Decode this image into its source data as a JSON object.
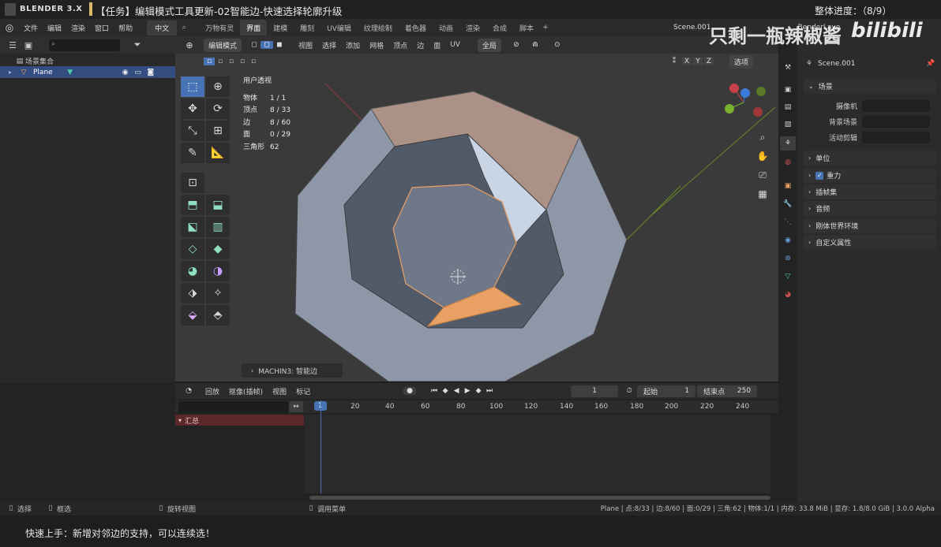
{
  "title_strip": {
    "app_name": "BLENDER 3.X",
    "task_title": "【任务】编辑模式工具更新-02智能边-快速选择轮廓升级",
    "progress": "整体进度：（8/9）"
  },
  "menubar": {
    "menus": [
      "文件",
      "编辑",
      "渲染",
      "窗口",
      "帮助"
    ],
    "language": "中文",
    "workspaces": [
      "万物有灵",
      "界面",
      "建模",
      "雕刻",
      "UV编辑",
      "纹理绘制",
      "着色器",
      "动画",
      "渲染",
      "合成",
      "脚本"
    ],
    "active_workspace": "界面",
    "scene_name": "Scene.001",
    "view_layer": "BenderLaye"
  },
  "watermark": {
    "text": "只剩一瓶辣椒酱",
    "brand": "bilibili"
  },
  "outliner": {
    "collection": "场景集合",
    "object": "Plane"
  },
  "viewport": {
    "mode": "编辑模式",
    "menus": [
      "视图",
      "选择",
      "添加",
      "网格",
      "顶点",
      "边",
      "面",
      "UV"
    ],
    "transform_orientation": "全局",
    "options_label": "选项",
    "axes": [
      "X",
      "Y",
      "Z"
    ],
    "view_name": "用户透视",
    "stats": [
      {
        "label": "物体",
        "value": "1 / 1"
      },
      {
        "label": "顶点",
        "value": "8 / 33"
      },
      {
        "label": "边",
        "value": "8 / 60"
      },
      {
        "label": "面",
        "value": "0 / 29"
      },
      {
        "label": "三角形",
        "value": "62"
      }
    ],
    "operator_panel": "MACHIN3: 智能边"
  },
  "properties": {
    "scene_name": "Scene.001",
    "scene_panel": "场景",
    "fields": [
      {
        "label": "摄像机"
      },
      {
        "label": "背景场景"
      },
      {
        "label": "活动剪辑"
      }
    ],
    "panels": [
      "单位",
      "重力",
      "插帧集",
      "音频",
      "刚体世界环境",
      "自定义属性"
    ]
  },
  "timeline": {
    "menus": [
      "回放",
      "抠像(插帧)",
      "视图",
      "标记"
    ],
    "current_frame": "1",
    "start_label": "起始",
    "start": "1",
    "end_label": "结束点",
    "end": "250",
    "ticks": [
      "1",
      "20",
      "40",
      "60",
      "80",
      "100",
      "120",
      "140",
      "160",
      "180",
      "200",
      "220",
      "240"
    ],
    "summary": "汇总"
  },
  "statusbar": {
    "left": [
      "选择",
      "框选",
      "旋转视图",
      "调用菜单"
    ],
    "right": "Plane | 点:8/33 | 边:8/60 | 面:0/29 | 三角:62 | 物体:1/1 | 内存: 33.8 MiB | 显存: 1.8/8.0 GiB | 3.0.0 Alpha"
  },
  "subtitle": "快速上手：新增对邻边的支持，可以连续选！",
  "colors": {
    "accent": "#4772b3",
    "selection_orange": "#e8a064",
    "summary_red": "#5a2828"
  }
}
